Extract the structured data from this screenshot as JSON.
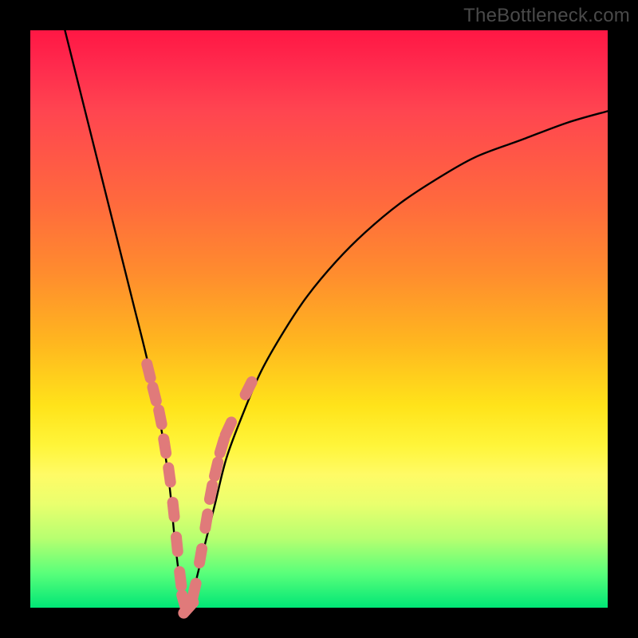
{
  "watermark": "TheBottleneck.com",
  "chart_data": {
    "type": "line",
    "title": "",
    "xlabel": "",
    "ylabel": "",
    "xlim": [
      0,
      100
    ],
    "ylim": [
      0,
      100
    ],
    "grid": false,
    "series": [
      {
        "name": "bottleneck-curve",
        "color": "#000000",
        "x": [
          6,
          8,
          10,
          12,
          14,
          16,
          18,
          20,
          22,
          24,
          25,
          26,
          27,
          28,
          30,
          32,
          34,
          37,
          40,
          44,
          48,
          53,
          58,
          64,
          70,
          77,
          85,
          93,
          100
        ],
        "y": [
          100,
          92,
          84,
          76,
          68,
          60,
          52,
          44,
          35,
          22,
          12,
          4,
          0,
          2,
          10,
          18,
          26,
          34,
          41,
          48,
          54,
          60,
          65,
          70,
          74,
          78,
          81,
          84,
          86
        ]
      }
    ],
    "markers": [
      {
        "name": "points-on-curve",
        "color": "#e07a7a",
        "shape": "capsule",
        "x": [
          20.5,
          21.5,
          22.5,
          23.3,
          24.1,
          24.8,
          25.4,
          26.0,
          26.6,
          27.4,
          28.4,
          29.5,
          30.5,
          31.3,
          32.2,
          33.2,
          34.3,
          37.8
        ],
        "y": [
          41,
          37,
          33,
          28,
          23,
          17,
          11,
          5,
          1,
          0,
          3,
          9,
          15,
          20,
          24,
          28,
          31,
          38
        ]
      }
    ]
  }
}
